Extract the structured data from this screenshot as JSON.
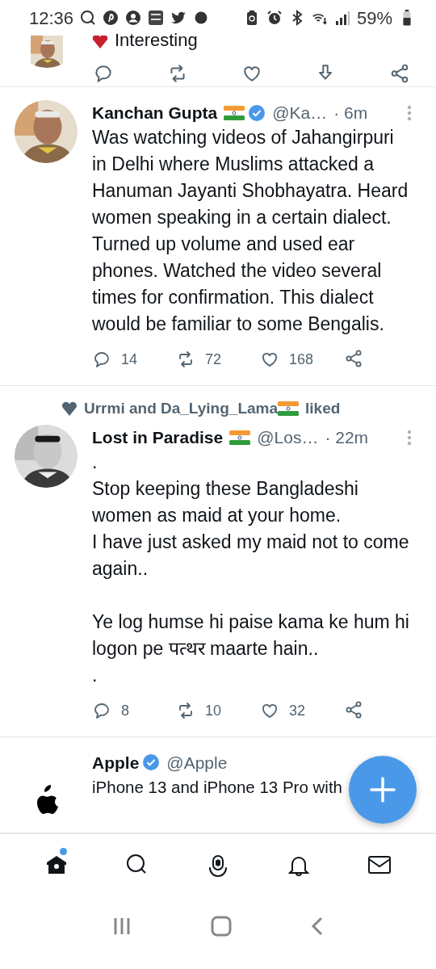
{
  "status_bar": {
    "time": "12:36",
    "battery": "59%"
  },
  "previous_tweet": {
    "text": "Interesting"
  },
  "tweets": [
    {
      "name": "Kanchan Gupta",
      "flag": true,
      "verified": true,
      "handle": "@Ka…",
      "time": "· 6m",
      "text": "Was watching videos of Jahangirpuri in Delhi where Muslims attacked a Hanuman Jayanti Shobhayatra. Heard women speaking in a certain dialect. Turned up volume and used ear phones. Watched the video several times for confirmation. This dialect would be familiar to some Bengalis.",
      "replies": "14",
      "retweets": "72",
      "likes": "168"
    },
    {
      "social_context": {
        "before": "Urrmi and Da_Lying_Lama",
        "after": "liked"
      },
      "name": "Lost in Paradise",
      "flag": true,
      "verified": false,
      "handle": "@Los…",
      "time": "· 22m",
      "text": ".\nStop keeping these Bangladeshi women as maid at your home.\nI have just asked my maid not to come again..\n\nYe log humse hi paise kama ke hum hi logon pe पत्थर maarte hain..\n.",
      "replies": "8",
      "retweets": "10",
      "likes": "32"
    },
    {
      "kind": "logo",
      "name": "Apple",
      "flag": false,
      "verified": true,
      "handle": "@Apple",
      "text": "iPhone 13 and iPhone 13 Pro with"
    }
  ],
  "bottom_nav": [
    {
      "kind": "home",
      "selected": true,
      "dot": true
    },
    {
      "kind": "search",
      "selected": false,
      "dot": false
    },
    {
      "kind": "spaces",
      "selected": false,
      "dot": false
    },
    {
      "kind": "notifications",
      "selected": false,
      "dot": false
    },
    {
      "kind": "messages",
      "selected": false,
      "dot": false
    }
  ]
}
